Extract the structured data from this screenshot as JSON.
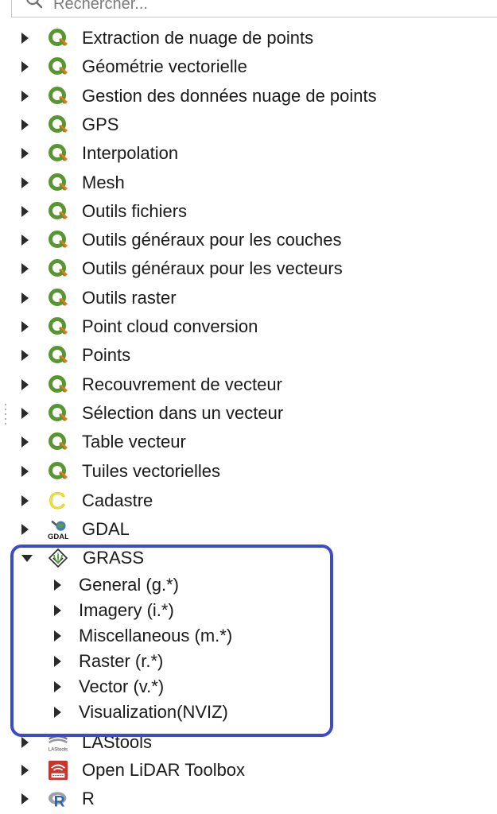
{
  "search": {
    "placeholder": "Rechercher..."
  },
  "tree": {
    "qgis_items": [
      "Extraction de nuage de points",
      "Géométrie vectorielle",
      "Gestion des données nuage de points",
      "GPS",
      "Interpolation",
      "Mesh",
      "Outils fichiers",
      "Outils généraux pour les couches",
      "Outils généraux pour les vecteurs",
      "Outils raster",
      "Point cloud conversion",
      "Points",
      "Recouvrement de vecteur",
      "Sélection dans un vecteur",
      "Table vecteur",
      "Tuiles vectorielles"
    ],
    "cadastre": {
      "label": "Cadastre",
      "icon": "cadastre-icon"
    },
    "gdal": {
      "label": "GDAL",
      "icon": "gdal-icon",
      "icon_text": "GDAL"
    },
    "grass": {
      "label": "GRASS",
      "icon": "grass-icon",
      "expanded": true,
      "children": [
        "General (g.*)",
        "Imagery (i.*)",
        "Miscellaneous (m.*)",
        "Raster (r.*)",
        "Vector (v.*)",
        "Visualization(NVIZ)"
      ]
    },
    "lastools": {
      "label": "LAStools",
      "icon": "lastools-icon",
      "icon_text": "LAStools"
    },
    "openlidar": {
      "label": "Open LiDAR Toolbox",
      "icon": "open-lidar-icon"
    },
    "r": {
      "label": "R",
      "icon": "r-icon"
    }
  },
  "colors": {
    "qgis_green": "#589632",
    "qgis_yellow": "#ee7913",
    "highlight_border": "#3c4bc8",
    "cadastre_yellow": "#f5e12a",
    "openlidar_red": "#d0322a",
    "r_blue": "#2266b8"
  }
}
